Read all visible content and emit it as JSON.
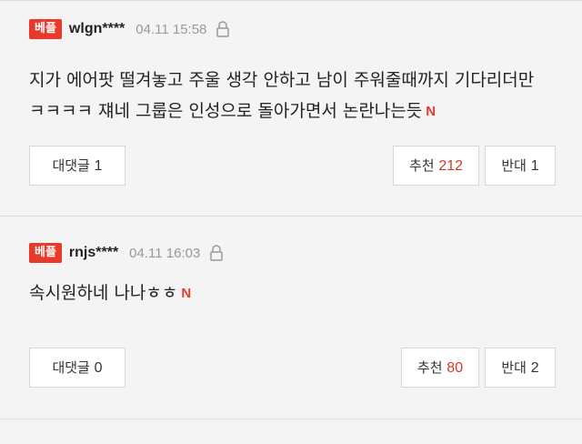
{
  "comments": [
    {
      "badge": "베플",
      "username": "wlgn****",
      "time": "04.11 15:58",
      "lines": [
        "지가 에어팟 떨겨놓고 주울 생각 안하고 남이 주워줄때까지 기다리더만",
        "ㅋㅋㅋㅋ 쟤네 그룹은 인성으로 돌아가면서 논란나는듯"
      ],
      "new_mark": "N",
      "reply_label": "대댓글",
      "reply_count": "1",
      "recommend_label": "추천",
      "recommend_count": "212",
      "oppose_label": "반대",
      "oppose_count": "1"
    },
    {
      "badge": "베플",
      "username": "rnjs****",
      "time": "04.11 16:03",
      "lines": [
        "속시원하네 나나ㅎㅎ"
      ],
      "new_mark": "N",
      "reply_label": "대댓글",
      "reply_count": "0",
      "recommend_label": "추천",
      "recommend_count": "80",
      "oppose_label": "반대",
      "oppose_count": "2"
    }
  ],
  "colors": {
    "badge": "#e8392b",
    "recommend_count": "#d6372c",
    "background": "#f4f4f4"
  },
  "icons": {
    "lock": "lock-icon",
    "new": "new-mark-icon"
  }
}
